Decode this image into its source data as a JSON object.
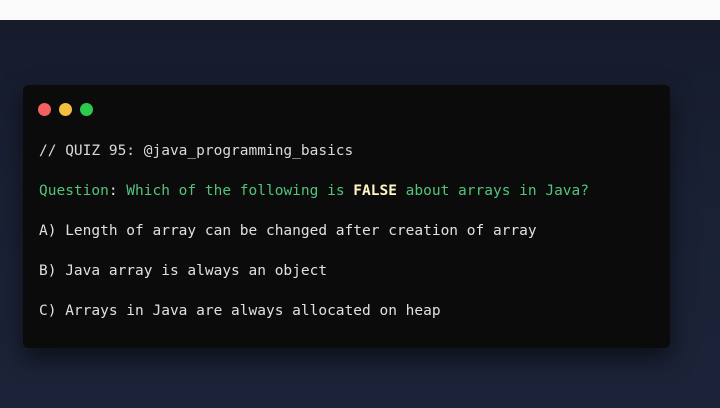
{
  "window": {
    "controls": {
      "close_color": "#f2605f",
      "minimize_color": "#f4be3e",
      "maximize_color": "#2ec94f"
    }
  },
  "quiz": {
    "comment": "// QUIZ 95: @java_programming_basics",
    "question_label": "Question",
    "question_colon": ":",
    "question_pre": " Which of the following is ",
    "question_emphasis": "FALSE",
    "question_post": " about arrays in Java?",
    "options": [
      "A) Length of array can be changed after creation of array",
      "B) Java array is always an object",
      "C) Arrays in Java are always allocated on heap"
    ]
  },
  "colors": {
    "background": "#1a2135",
    "window": "#0c0b0b",
    "question_text": "#52c47a",
    "emphasis": "#fff6c4"
  }
}
